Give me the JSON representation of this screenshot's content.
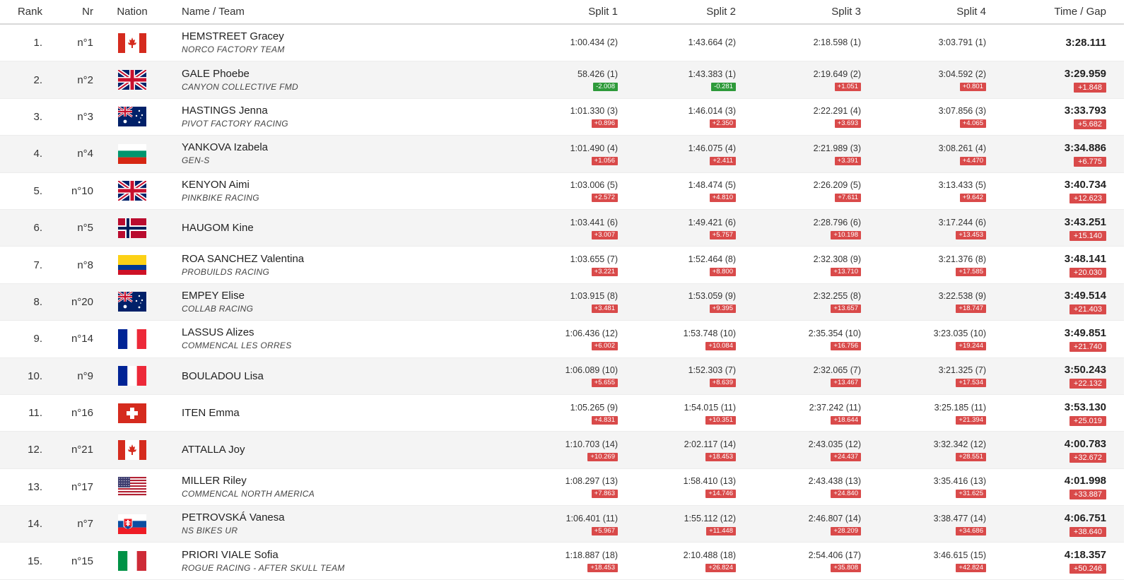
{
  "headers": {
    "rank": "Rank",
    "nr": "Nr",
    "nation": "Nation",
    "name": "Name / Team",
    "split1": "Split 1",
    "split2": "Split 2",
    "split3": "Split 3",
    "split4": "Split 4",
    "time": "Time / Gap"
  },
  "colors": {
    "gap_positive": "#d94a4a",
    "gap_negative": "#2e9a3a",
    "row_alt": "#f4f4f4"
  },
  "rows": [
    {
      "rank": "1.",
      "nr": "n°1",
      "flag": "CAN",
      "name": "HEMSTREET Gracey",
      "team": "NORCO FACTORY TEAM",
      "s1": "1:00.434 (2)",
      "g1": "",
      "s2": "1:43.664 (2)",
      "g2": "",
      "s3": "2:18.598 (1)",
      "g3": "",
      "s4": "3:03.791 (1)",
      "g4": "",
      "time": "3:28.111",
      "gap": ""
    },
    {
      "rank": "2.",
      "nr": "n°2",
      "flag": "GBR",
      "name": "GALE Phoebe",
      "team": "CANYON COLLECTIVE FMD",
      "s1": "58.426 (1)",
      "g1": "-2.008",
      "s2": "1:43.383 (1)",
      "g2": "-0.281",
      "s3": "2:19.649 (2)",
      "g3": "+1.051",
      "s4": "3:04.592 (2)",
      "g4": "+0.801",
      "time": "3:29.959",
      "gap": "+1.848"
    },
    {
      "rank": "3.",
      "nr": "n°3",
      "flag": "AUS",
      "name": "HASTINGS Jenna",
      "team": "PIVOT FACTORY RACING",
      "s1": "1:01.330 (3)",
      "g1": "+0.896",
      "s2": "1:46.014 (3)",
      "g2": "+2.350",
      "s3": "2:22.291 (4)",
      "g3": "+3.693",
      "s4": "3:07.856 (3)",
      "g4": "+4.065",
      "time": "3:33.793",
      "gap": "+5.682"
    },
    {
      "rank": "4.",
      "nr": "n°4",
      "flag": "BUL",
      "name": "YANKOVA Izabela",
      "team": "GEN-S",
      "s1": "1:01.490 (4)",
      "g1": "+1.056",
      "s2": "1:46.075 (4)",
      "g2": "+2.411",
      "s3": "2:21.989 (3)",
      "g3": "+3.391",
      "s4": "3:08.261 (4)",
      "g4": "+4.470",
      "time": "3:34.886",
      "gap": "+6.775"
    },
    {
      "rank": "5.",
      "nr": "n°10",
      "flag": "GBR",
      "name": "KENYON Aimi",
      "team": "PINKBIKE RACING",
      "s1": "1:03.006 (5)",
      "g1": "+2.572",
      "s2": "1:48.474 (5)",
      "g2": "+4.810",
      "s3": "2:26.209 (5)",
      "g3": "+7.611",
      "s4": "3:13.433 (5)",
      "g4": "+9.642",
      "time": "3:40.734",
      "gap": "+12.623"
    },
    {
      "rank": "6.",
      "nr": "n°5",
      "flag": "NOR",
      "name": "HAUGOM Kine",
      "team": "",
      "s1": "1:03.441 (6)",
      "g1": "+3.007",
      "s2": "1:49.421 (6)",
      "g2": "+5.757",
      "s3": "2:28.796 (6)",
      "g3": "+10.198",
      "s4": "3:17.244 (6)",
      "g4": "+13.453",
      "time": "3:43.251",
      "gap": "+15.140"
    },
    {
      "rank": "7.",
      "nr": "n°8",
      "flag": "COL",
      "name": "ROA SANCHEZ Valentina",
      "team": "PROBUILDS RACING",
      "s1": "1:03.655 (7)",
      "g1": "+3.221",
      "s2": "1:52.464 (8)",
      "g2": "+8.800",
      "s3": "2:32.308 (9)",
      "g3": "+13.710",
      "s4": "3:21.376 (8)",
      "g4": "+17.585",
      "time": "3:48.141",
      "gap": "+20.030"
    },
    {
      "rank": "8.",
      "nr": "n°20",
      "flag": "AUS",
      "name": "EMPEY Elise",
      "team": "COLLAB RACING",
      "s1": "1:03.915 (8)",
      "g1": "+3.481",
      "s2": "1:53.059 (9)",
      "g2": "+9.395",
      "s3": "2:32.255 (8)",
      "g3": "+13.657",
      "s4": "3:22.538 (9)",
      "g4": "+18.747",
      "time": "3:49.514",
      "gap": "+21.403"
    },
    {
      "rank": "9.",
      "nr": "n°14",
      "flag": "FRA",
      "name": "LASSUS Alizes",
      "team": "COMMENCAL LES ORRES",
      "s1": "1:06.436 (12)",
      "g1": "+6.002",
      "s2": "1:53.748 (10)",
      "g2": "+10.084",
      "s3": "2:35.354 (10)",
      "g3": "+16.756",
      "s4": "3:23.035 (10)",
      "g4": "+19.244",
      "time": "3:49.851",
      "gap": "+21.740"
    },
    {
      "rank": "10.",
      "nr": "n°9",
      "flag": "FRA",
      "name": "BOULADOU Lisa",
      "team": "",
      "s1": "1:06.089 (10)",
      "g1": "+5.655",
      "s2": "1:52.303 (7)",
      "g2": "+8.639",
      "s3": "2:32.065 (7)",
      "g3": "+13.467",
      "s4": "3:21.325 (7)",
      "g4": "+17.534",
      "time": "3:50.243",
      "gap": "+22.132"
    },
    {
      "rank": "11.",
      "nr": "n°16",
      "flag": "SUI",
      "name": "ITEN Emma",
      "team": "",
      "s1": "1:05.265 (9)",
      "g1": "+4.831",
      "s2": "1:54.015 (11)",
      "g2": "+10.351",
      "s3": "2:37.242 (11)",
      "g3": "+18.644",
      "s4": "3:25.185 (11)",
      "g4": "+21.394",
      "time": "3:53.130",
      "gap": "+25.019"
    },
    {
      "rank": "12.",
      "nr": "n°21",
      "flag": "CAN",
      "name": "ATTALLA Joy",
      "team": "",
      "s1": "1:10.703 (14)",
      "g1": "+10.269",
      "s2": "2:02.117 (14)",
      "g2": "+18.453",
      "s3": "2:43.035 (12)",
      "g3": "+24.437",
      "s4": "3:32.342 (12)",
      "g4": "+28.551",
      "time": "4:00.783",
      "gap": "+32.672"
    },
    {
      "rank": "13.",
      "nr": "n°17",
      "flag": "USA",
      "name": "MILLER Riley",
      "team": "COMMENCAL NORTH AMERICA",
      "s1": "1:08.297 (13)",
      "g1": "+7.863",
      "s2": "1:58.410 (13)",
      "g2": "+14.746",
      "s3": "2:43.438 (13)",
      "g3": "+24.840",
      "s4": "3:35.416 (13)",
      "g4": "+31.625",
      "time": "4:01.998",
      "gap": "+33.887"
    },
    {
      "rank": "14.",
      "nr": "n°7",
      "flag": "SVK",
      "name": "PETROVSKÁ Vanesa",
      "team": "NS BIKES UR",
      "s1": "1:06.401 (11)",
      "g1": "+5.967",
      "s2": "1:55.112 (12)",
      "g2": "+11.448",
      "s3": "2:46.807 (14)",
      "g3": "+28.209",
      "s4": "3:38.477 (14)",
      "g4": "+34.686",
      "time": "4:06.751",
      "gap": "+38.640"
    },
    {
      "rank": "15.",
      "nr": "n°15",
      "flag": "ITA",
      "name": "PRIORI VIALE Sofia",
      "team": "ROGUE RACING - AFTER SKULL TEAM",
      "s1": "1:18.887 (18)",
      "g1": "+18.453",
      "s2": "2:10.488 (18)",
      "g2": "+26.824",
      "s3": "2:54.406 (17)",
      "g3": "+35.808",
      "s4": "3:46.615 (15)",
      "g4": "+42.824",
      "time": "4:18.357",
      "gap": "+50.246"
    }
  ]
}
